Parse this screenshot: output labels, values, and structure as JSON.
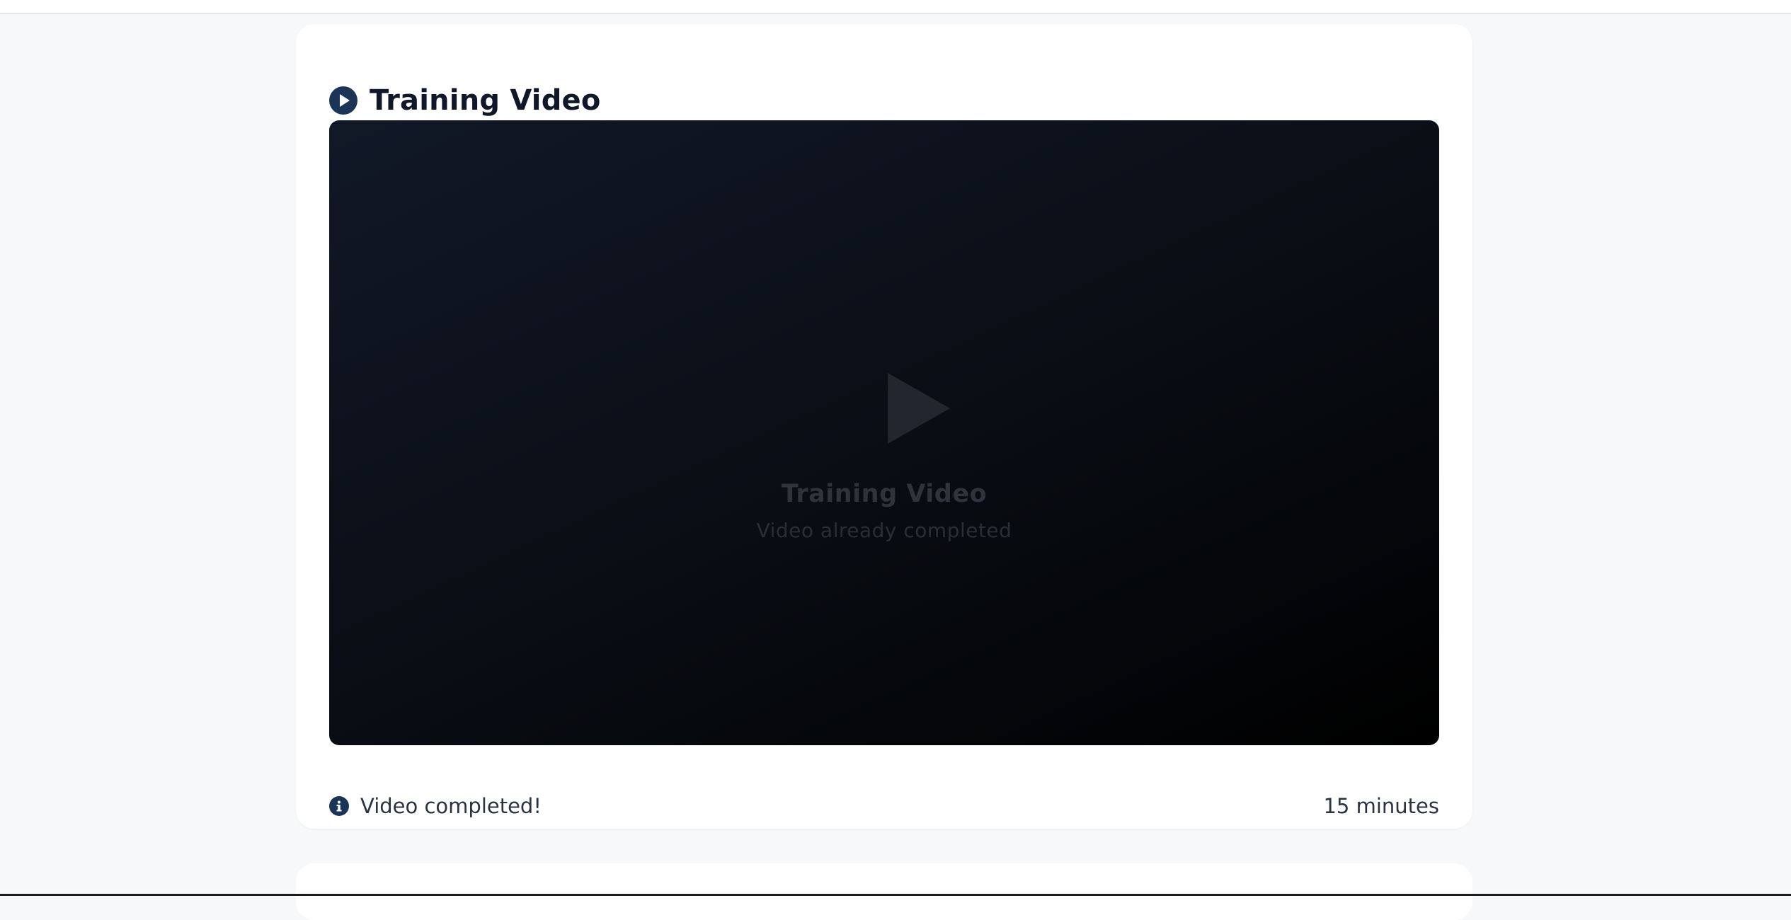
{
  "training_video": {
    "title": "Training Video",
    "header_icon": "play-circle-icon",
    "player": {
      "play_icon": "play-icon",
      "title": "Training Video",
      "subtitle": "Video already completed"
    },
    "status": {
      "icon": "info-icon",
      "text": "Video completed!"
    },
    "duration": "15 minutes"
  },
  "colors": {
    "accent": "#1b3557",
    "page_background": "#f7f8fa",
    "card_background": "#ffffff",
    "title_text": "#0f1729",
    "body_text": "#2b3240",
    "player_background": "#0a0e15"
  }
}
